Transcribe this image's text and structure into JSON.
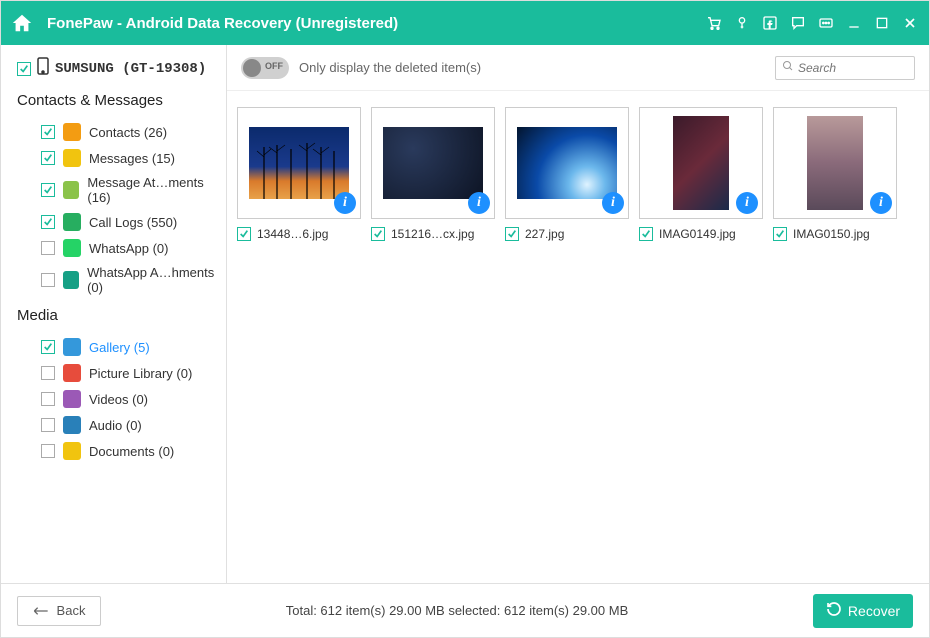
{
  "titlebar": {
    "title": "FonePaw - Android Data Recovery (Unregistered)"
  },
  "sidebar": {
    "device_name": "SUMSUNG (GT-19308)",
    "section1_title": "Contacts & Messages",
    "section2_title": "Media",
    "contacts_messages": [
      {
        "label": "Contacts (26)",
        "checked": true,
        "icon_bg": "#f39c12",
        "icon_name": "contacts-icon"
      },
      {
        "label": "Messages (15)",
        "checked": true,
        "icon_bg": "#f1c40f",
        "icon_name": "messages-icon"
      },
      {
        "label": "Message At…ments (16)",
        "checked": true,
        "icon_bg": "#8bc34a",
        "icon_name": "message-attachments-icon"
      },
      {
        "label": "Call Logs (550)",
        "checked": true,
        "icon_bg": "#27ae60",
        "icon_name": "call-logs-icon"
      },
      {
        "label": "WhatsApp (0)",
        "checked": false,
        "icon_bg": "#25d366",
        "icon_name": "whatsapp-icon"
      },
      {
        "label": "WhatsApp A…hments (0)",
        "checked": false,
        "icon_bg": "#16a085",
        "icon_name": "whatsapp-attachments-icon"
      }
    ],
    "media": [
      {
        "label": "Gallery (5)",
        "checked": true,
        "selected": true,
        "icon_bg": "#3498db",
        "icon_name": "gallery-icon"
      },
      {
        "label": "Picture Library (0)",
        "checked": false,
        "icon_bg": "#e74c3c",
        "icon_name": "picture-library-icon"
      },
      {
        "label": "Videos (0)",
        "checked": false,
        "icon_bg": "#9b59b6",
        "icon_name": "videos-icon"
      },
      {
        "label": "Audio (0)",
        "checked": false,
        "icon_bg": "#2980b9",
        "icon_name": "audio-icon"
      },
      {
        "label": "Documents (0)",
        "checked": false,
        "icon_bg": "#f1c40f",
        "icon_name": "documents-icon"
      }
    ]
  },
  "toolbar": {
    "toggle_label": "OFF",
    "filter_text": "Only display the deleted item(s)",
    "search_placeholder": "Search"
  },
  "grid": {
    "items": [
      {
        "label": "13448…6.jpg",
        "checked": true,
        "portrait": false,
        "bg": "linear-gradient(180deg,#0b2a6c 0%,#1a3a8c 55%,#d97a2b 75%,#e8a24a 100%)",
        "overlay": "trees"
      },
      {
        "label": "151216…cx.jpg",
        "checked": true,
        "portrait": false,
        "bg": "radial-gradient(circle at 30% 30%,#2a3a5c,#0d1424)",
        "overlay": ""
      },
      {
        "label": "227.jpg",
        "checked": true,
        "portrait": false,
        "bg": "radial-gradient(circle at 70% 80%,#dff3ff 0%,#6cb8ec 20%,#0a4aa8 55%,#02142e 100%)",
        "overlay": ""
      },
      {
        "label": "IMAG0149.jpg",
        "checked": true,
        "portrait": true,
        "bg": "linear-gradient(135deg,#3a1a2a,#6a2a3a,#1a2a4a)",
        "overlay": ""
      },
      {
        "label": "IMAG0150.jpg",
        "checked": true,
        "portrait": true,
        "bg": "linear-gradient(180deg,#b89a9a,#8a6a7a,#5a4a5a)",
        "overlay": ""
      }
    ]
  },
  "footer": {
    "back_label": "Back",
    "status_text": "Total: 612 item(s) 29.00 MB   selected: 612 item(s) 29.00 MB",
    "recover_label": "Recover"
  },
  "info_badge": "i"
}
